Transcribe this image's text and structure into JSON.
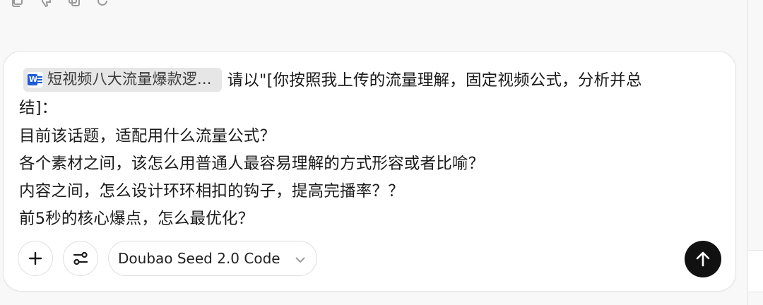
{
  "message_actions": [
    {
      "icon": "copy-icon"
    },
    {
      "icon": "thumbs-down-icon"
    },
    {
      "icon": "duplicate-icon"
    },
    {
      "icon": "regenerate-icon"
    }
  ],
  "composer": {
    "attachment": {
      "icon": "word-document-icon",
      "name": "短视频八大流量爆款逻..."
    },
    "lines": [
      "请以\"[你按照我上传的流量理解，固定视频公式，分析并总",
      "结]：",
      "目前该话题，适配用什么流量公式？",
      "各个素材之间，该怎么用普通人最容易理解的方式形容或者比喻？",
      "内容之间，怎么设计环环相扣的钩子，提高完播率？？",
      "前5秒的核心爆点，怎么最优化？"
    ]
  },
  "toolbar": {
    "add_icon": "plus-icon",
    "settings_icon": "sliders-icon",
    "model_label": "Doubao Seed 2.0 Code",
    "model_chevron": "chevron-down-icon",
    "send_icon": "arrow-up-icon"
  },
  "colors": {
    "send_button": "#111111",
    "chip_bg": "#e6e6e6",
    "word_blue": "#1e5bd7"
  }
}
